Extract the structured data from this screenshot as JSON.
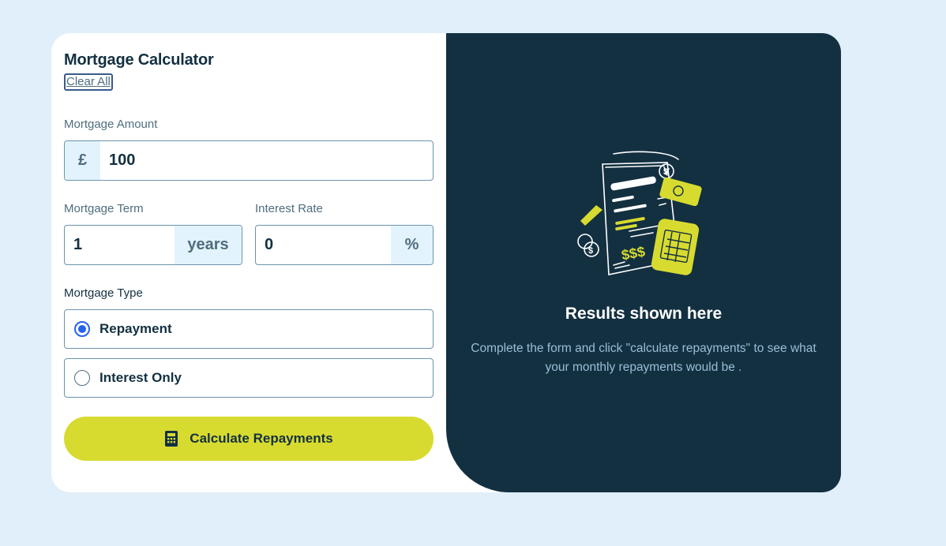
{
  "app": {
    "title": "Mortgage Calculator",
    "clear_label": "Clear All"
  },
  "fields": {
    "amount": {
      "label": "Mortgage Amount",
      "prefix": "£",
      "value": "100"
    },
    "term": {
      "label": "Mortgage Term",
      "value": "1",
      "suffix": "years"
    },
    "rate": {
      "label": "Interest Rate",
      "value": "0",
      "suffix": "%"
    }
  },
  "mortgage_type": {
    "label": "Mortgage Type",
    "options": [
      {
        "label": "Repayment",
        "selected": true
      },
      {
        "label": "Interest Only",
        "selected": false
      }
    ]
  },
  "submit": {
    "label": "Calculate Repayments",
    "icon": "calculator-icon"
  },
  "results": {
    "title": "Results shown here",
    "description": "Complete the form and click \"calculate repayments\" to see what your monthly repayments would be ."
  },
  "colors": {
    "page_bg": "#e0eff9",
    "dark": "#133041",
    "accent_lime": "#d8db2f",
    "radio_blue": "#2563eb",
    "muted": "#4e6e7e"
  }
}
